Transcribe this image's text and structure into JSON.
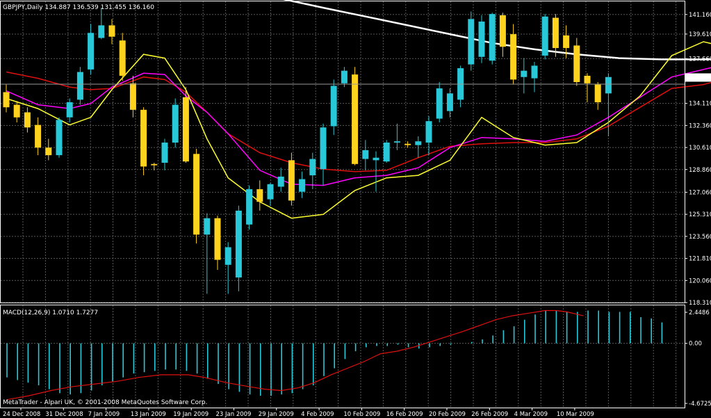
{
  "header": {
    "symbol_tf": "GBPJPY,Daily",
    "ohlc": "134.887 136.539 131.455 136.160"
  },
  "footer": {
    "copyright": "MetaTrader - Alpari UK, © 2001-2008 MetaQuotes Software Corp."
  },
  "chart_data": [
    {
      "type": "candlestick",
      "title": "GBPJPY,Daily",
      "ylim": [
        118.31,
        142.2
      ],
      "y_ticks": [
        "141.160",
        "139.610",
        "137.660",
        "136.160",
        "134.110",
        "132.360",
        "130.610",
        "128.860",
        "127.060",
        "125.310",
        "123.560",
        "121.810",
        "120.060",
        "118.310"
      ],
      "current_price": "136.160",
      "x_labels": [
        "24 Dec 2008",
        "31 Dec 2008",
        "7 Jan 2009",
        "13 Jan 2009",
        "19 Jan 2009",
        "23 Jan 2009",
        "29 Jan 2009",
        "4 Feb 2009",
        "10 Feb 2009",
        "16 Feb 2009",
        "20 Feb 2009",
        "26 Feb 2009",
        "4 Mar 2009",
        "10 Mar 2009"
      ],
      "colors": {
        "bull": "#28c8d8",
        "bear": "#ffd21e",
        "grid": "#5a5a5a",
        "ma_white": "#ffffff",
        "ma_red": "#e01010",
        "ma_magenta": "#ff00ff",
        "ma_yellow": "#ffff30"
      },
      "candles": [
        [
          135.0,
          135.6,
          133.4,
          133.8
        ],
        [
          134.0,
          134.3,
          132.6,
          133.0
        ],
        [
          133.4,
          133.8,
          131.8,
          132.2
        ],
        [
          132.4,
          133.0,
          130.0,
          130.6
        ],
        [
          130.6,
          131.3,
          129.6,
          130.0
        ],
        [
          130.0,
          133.0,
          129.8,
          132.8
        ],
        [
          133.0,
          134.5,
          132.6,
          134.2
        ],
        [
          134.4,
          137.0,
          134.0,
          136.6
        ],
        [
          136.8,
          140.4,
          136.4,
          139.7
        ],
        [
          139.3,
          141.7,
          139.2,
          140.3
        ],
        [
          140.3,
          140.8,
          138.8,
          139.4
        ],
        [
          139.1,
          139.7,
          135.9,
          136.3
        ],
        [
          135.7,
          136.3,
          133.0,
          133.6
        ],
        [
          133.6,
          133.8,
          128.4,
          129.1
        ],
        [
          129.3,
          129.4,
          128.8,
          129.2
        ],
        [
          129.4,
          131.3,
          128.8,
          131.0
        ],
        [
          131.0,
          134.5,
          130.6,
          134.0
        ],
        [
          134.6,
          135.4,
          129.4,
          129.5
        ],
        [
          130.1,
          130.5,
          123.0,
          123.7
        ],
        [
          123.7,
          125.4,
          119.0,
          125.0
        ],
        [
          125.0,
          125.2,
          120.9,
          121.7
        ],
        [
          121.3,
          123.1,
          119.0,
          122.7
        ],
        [
          120.3,
          126.0,
          119.2,
          125.6
        ],
        [
          124.5,
          127.6,
          124.1,
          127.3
        ],
        [
          127.3,
          128.0,
          125.6,
          126.3
        ],
        [
          126.5,
          127.8,
          126.0,
          127.7
        ],
        [
          127.5,
          129.0,
          127.1,
          128.3
        ],
        [
          129.6,
          130.2,
          126.0,
          126.4
        ],
        [
          127.1,
          128.7,
          126.6,
          128.1
        ],
        [
          128.4,
          130.2,
          127.3,
          129.7
        ],
        [
          128.9,
          132.5,
          127.6,
          132.2
        ],
        [
          132.3,
          136.0,
          131.6,
          135.5
        ],
        [
          135.7,
          137.0,
          135.4,
          136.7
        ],
        [
          136.4,
          137.0,
          129.2,
          129.3
        ],
        [
          129.7,
          131.2,
          128.8,
          130.4
        ],
        [
          129.6,
          130.3,
          127.1,
          129.8
        ],
        [
          129.5,
          131.2,
          129.4,
          131.0
        ],
        [
          131.0,
          132.5,
          130.4,
          131.1
        ],
        [
          130.9,
          131.1,
          130.6,
          130.8
        ],
        [
          130.8,
          131.5,
          129.8,
          131.1
        ],
        [
          131.0,
          133.1,
          130.0,
          132.7
        ],
        [
          132.9,
          135.8,
          132.6,
          135.3
        ],
        [
          133.5,
          135.3,
          133.0,
          134.9
        ],
        [
          134.4,
          137.1,
          133.8,
          136.9
        ],
        [
          137.2,
          141.4,
          136.7,
          140.8
        ],
        [
          137.8,
          141.1,
          137.3,
          140.6
        ],
        [
          137.5,
          141.3,
          137.2,
          141.2
        ],
        [
          141.1,
          141.3,
          137.8,
          138.6
        ],
        [
          139.6,
          140.4,
          135.6,
          136.0
        ],
        [
          136.2,
          137.7,
          134.9,
          136.7
        ],
        [
          136.1,
          137.4,
          135.0,
          137.1
        ],
        [
          137.9,
          141.2,
          137.6,
          141.0
        ],
        [
          140.9,
          141.2,
          137.8,
          138.5
        ],
        [
          139.5,
          140.3,
          137.7,
          138.5
        ],
        [
          138.7,
          139.3,
          135.5,
          135.8
        ],
        [
          136.3,
          136.5,
          134.2,
          135.7
        ],
        [
          135.6,
          135.8,
          133.6,
          134.2
        ],
        [
          134.9,
          136.5,
          131.5,
          136.2
        ]
      ],
      "ma_white": [
        [
          25,
          142.6
        ],
        [
          30,
          141.7
        ],
        [
          34,
          141.0
        ],
        [
          38,
          140.3
        ],
        [
          42,
          139.6
        ],
        [
          46,
          138.9
        ],
        [
          50,
          138.4
        ],
        [
          54,
          138.0
        ],
        [
          58,
          137.7
        ],
        [
          62,
          137.6
        ],
        [
          66,
          137.6
        ],
        [
          72,
          137.7
        ],
        [
          77,
          137.9
        ],
        [
          81,
          137.9
        ],
        [
          83,
          137.9
        ]
      ],
      "ma_red": [
        [
          0,
          136.6
        ],
        [
          3,
          136.1
        ],
        [
          6,
          135.4
        ],
        [
          8,
          135.2
        ],
        [
          10,
          135.3
        ],
        [
          13,
          136.2
        ],
        [
          15,
          136.0
        ],
        [
          17,
          135.0
        ],
        [
          19,
          133.4
        ],
        [
          21,
          131.7
        ],
        [
          24,
          130.2
        ],
        [
          27,
          129.4
        ],
        [
          30,
          128.9
        ],
        [
          33,
          128.7
        ],
        [
          36,
          128.8
        ],
        [
          39,
          129.8
        ],
        [
          42,
          130.7
        ],
        [
          45,
          130.9
        ],
        [
          48,
          131.0
        ],
        [
          51,
          131.0
        ],
        [
          54,
          131.3
        ],
        [
          57,
          132.3
        ],
        [
          60,
          133.8
        ],
        [
          63,
          135.3
        ],
        [
          66,
          135.6
        ],
        [
          69,
          136.3
        ],
        [
          72,
          137.0
        ],
        [
          75,
          137.1
        ],
        [
          78,
          136.7
        ],
        [
          81,
          136.4
        ],
        [
          83,
          136.3
        ]
      ],
      "ma_magenta": [
        [
          0,
          135.1
        ],
        [
          3,
          134.0
        ],
        [
          6,
          133.7
        ],
        [
          8,
          134.1
        ],
        [
          10,
          135.4
        ],
        [
          13,
          136.5
        ],
        [
          15,
          136.4
        ],
        [
          17,
          134.7
        ],
        [
          19,
          133.4
        ],
        [
          21,
          131.7
        ],
        [
          24,
          128.8
        ],
        [
          27,
          127.7
        ],
        [
          30,
          127.6
        ],
        [
          33,
          128.2
        ],
        [
          36,
          128.4
        ],
        [
          39,
          129.0
        ],
        [
          42,
          130.6
        ],
        [
          45,
          131.4
        ],
        [
          48,
          131.3
        ],
        [
          51,
          131.1
        ],
        [
          54,
          131.6
        ],
        [
          57,
          133.0
        ],
        [
          60,
          134.6
        ],
        [
          63,
          136.2
        ],
        [
          66,
          136.8
        ],
        [
          69,
          137.4
        ],
        [
          72,
          137.9
        ],
        [
          75,
          138.1
        ],
        [
          78,
          137.9
        ],
        [
          81,
          137.0
        ],
        [
          83,
          136.8
        ]
      ],
      "ma_yellow": [
        [
          0,
          134.5
        ],
        [
          3,
          133.7
        ],
        [
          6,
          132.4
        ],
        [
          8,
          133.0
        ],
        [
          10,
          135.2
        ],
        [
          13,
          138.0
        ],
        [
          15,
          137.7
        ],
        [
          17,
          135.2
        ],
        [
          19,
          131.3
        ],
        [
          21,
          128.2
        ],
        [
          24,
          126.3
        ],
        [
          27,
          125.0
        ],
        [
          30,
          125.3
        ],
        [
          33,
          127.2
        ],
        [
          36,
          128.2
        ],
        [
          39,
          128.4
        ],
        [
          42,
          129.6
        ],
        [
          45,
          133.0
        ],
        [
          48,
          131.4
        ],
        [
          51,
          130.8
        ],
        [
          54,
          131.0
        ],
        [
          57,
          132.6
        ],
        [
          60,
          134.7
        ],
        [
          63,
          137.9
        ],
        [
          66,
          139.0
        ],
        [
          69,
          138.4
        ],
        [
          72,
          139.0
        ],
        [
          75,
          138.9
        ],
        [
          78,
          137.6
        ],
        [
          81,
          136.3
        ],
        [
          83,
          136.5
        ]
      ]
    },
    {
      "type": "histogram+line",
      "title": "MACD(12,26,9) 1.0710 1.7277",
      "ylim": [
        -4.9,
        2.9
      ],
      "y_ticks": [
        "2.4486",
        "0.00",
        "-4.6725"
      ],
      "histogram": [
        -2.6,
        -2.8,
        -3.0,
        -3.2,
        -3.5,
        -3.8,
        -3.9,
        -3.8,
        -3.6,
        -3.2,
        -2.9,
        -2.6,
        -2.3,
        -2.2,
        -2.1,
        -2.0,
        -2.0,
        -2.1,
        -2.3,
        -2.7,
        -3.1,
        -3.5,
        -3.7,
        -3.9,
        -4.0,
        -4.0,
        -3.9,
        -3.8,
        -3.5,
        -3.2,
        -2.5,
        -1.9,
        -1.2,
        -0.6,
        -0.3,
        -0.2,
        -0.2,
        -0.1,
        -0.3,
        -0.4,
        -0.3,
        -0.2,
        -0.1,
        0.0,
        0.1,
        0.3,
        0.6,
        1.0,
        1.3,
        1.8,
        2.2,
        2.5,
        2.5,
        2.4,
        2.4,
        2.5,
        2.5,
        2.4,
        2.4,
        2.4,
        2.0,
        1.9,
        1.6,
        1.3,
        1.1,
        1.3
      ],
      "signal": [
        [
          0,
          -4.3
        ],
        [
          4,
          -4.0
        ],
        [
          8,
          -3.6
        ],
        [
          12,
          -3.3
        ],
        [
          16,
          -3.1
        ],
        [
          20,
          -2.9
        ],
        [
          24,
          -2.6
        ],
        [
          28,
          -2.4
        ],
        [
          30,
          -2.4
        ],
        [
          33,
          -2.4
        ],
        [
          36,
          -2.6
        ],
        [
          40,
          -3.0
        ],
        [
          44,
          -3.3
        ],
        [
          47,
          -3.5
        ],
        [
          50,
          -3.6
        ],
        [
          53,
          -3.4
        ],
        [
          56,
          -3.0
        ],
        [
          59,
          -2.4
        ],
        [
          62,
          -1.9
        ],
        [
          65,
          -1.4
        ],
        [
          68,
          -0.8
        ],
        [
          71,
          -0.6
        ],
        [
          74,
          -0.3
        ],
        [
          77,
          0.1
        ],
        [
          80,
          0.5
        ],
        [
          83,
          0.9
        ],
        [
          85,
          1.2
        ],
        [
          87,
          1.5
        ],
        [
          89,
          1.8
        ],
        [
          92,
          2.1
        ],
        [
          95,
          2.3
        ],
        [
          98,
          2.5
        ],
        [
          100,
          2.5
        ],
        [
          102,
          2.4
        ],
        [
          104,
          2.2
        ],
        [
          105,
          2.1
        ]
      ]
    }
  ]
}
